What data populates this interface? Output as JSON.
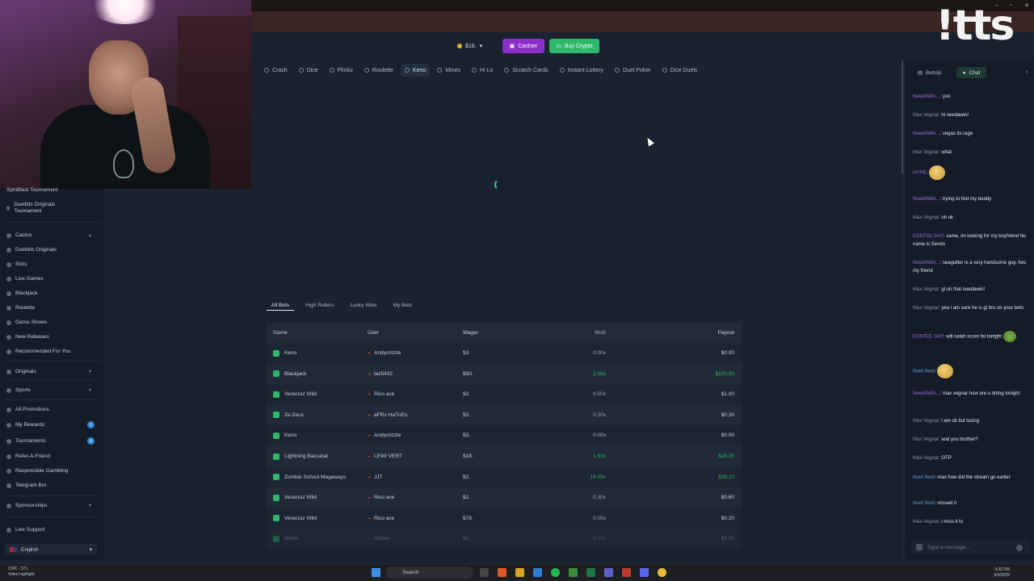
{
  "header": {
    "balance": "$18.",
    "cashier_label": "Cashier",
    "buycrypto_label": "Buy Crypto"
  },
  "game_nav": [
    {
      "label": "Crash",
      "icon": "crash-icon"
    },
    {
      "label": "Dice",
      "icon": "dice-icon"
    },
    {
      "label": "Plinko",
      "icon": "plinko-icon"
    },
    {
      "label": "Roulette",
      "icon": "roulette-icon"
    },
    {
      "label": "Keno",
      "icon": "keno-icon",
      "active": true
    },
    {
      "label": "Mines",
      "icon": "mines-icon"
    },
    {
      "label": "Hi Lo",
      "icon": "hilo-icon"
    },
    {
      "label": "Scratch Cards",
      "icon": "scratch-icon"
    },
    {
      "label": "Instant Lottery",
      "icon": "lottery-icon"
    },
    {
      "label": "Duel Poker",
      "icon": "poker-icon"
    },
    {
      "label": "Dice Duels",
      "icon": "dice-duels-icon"
    }
  ],
  "watermark": {
    "text": "!tts"
  },
  "sidebar": {
    "top_items": [
      "SpinBlast Tournament",
      "Duelbits Originals Tournament"
    ],
    "casino_label": "Casino",
    "casino_items": [
      "Duelbits Originals",
      "Slots",
      "Live Games",
      "Blackjack",
      "Roulette",
      "Game Shows",
      "New Releases",
      "Recommended For You"
    ],
    "originals_label": "Originals",
    "sports_label": "Sports",
    "promo_items": [
      "All Promotions",
      "My Rewards",
      "Tournaments",
      "Refer-A-Friend",
      "Responsible Gambling",
      "Telegram Bot"
    ],
    "badges": {
      "rewards": "1",
      "tournaments": "8"
    },
    "sponsorships_label": "Sponsorships",
    "live_support_label": "Live Support",
    "language": "English"
  },
  "bets": {
    "tabs": [
      "All Bets",
      "High Rollers",
      "Lucky Wins",
      "My Bets"
    ],
    "columns": [
      "Game",
      "User",
      "Wager",
      "Multi",
      "Payout"
    ],
    "rows": [
      {
        "game": "Keno",
        "user": "Andycrizzle",
        "wager": "$3.",
        "multi": "0.00x",
        "payout": "$0.00",
        "win": false
      },
      {
        "game": "Blackjack",
        "user": "taz5432",
        "wager": "$50.",
        "multi": "2.00x",
        "payout": "$100.00",
        "win": true
      },
      {
        "game": "Veracruz Wild",
        "user": "Rico ace",
        "wager": "$2.",
        "multi": "0.50x",
        "payout": "$1.00",
        "win": false
      },
      {
        "game": "Ze Zeus",
        "user": "aFRo HaTnEs",
        "wager": "$3.",
        "multi": "0.10x",
        "payout": "$0.30",
        "win": false
      },
      {
        "game": "Keno",
        "user": "Andycrizzle",
        "wager": "$3.",
        "multi": "0.00x",
        "payout": "$0.00",
        "win": false
      },
      {
        "game": "Lightning Baccarat",
        "user": "LEWI VERT",
        "wager": "$18.",
        "multi": "1.63x",
        "payout": "$29.25",
        "win": true
      },
      {
        "game": "Zombie School Megaways",
        "user": "JJT",
        "wager": "$2.",
        "multi": "19.55x",
        "payout": "$39.10",
        "win": true
      },
      {
        "game": "Veracruz Wild",
        "user": "Rico ace",
        "wager": "$2.",
        "multi": "0.30x",
        "payout": "$0.60",
        "win": false
      },
      {
        "game": "Veracruz Wild",
        "user": "Rico ace",
        "wager": "$79.",
        "multi": "0.00x",
        "payout": "$0.20",
        "win": false
      },
      {
        "game": "Mines",
        "user": "Hidden",
        "wager": "$2.",
        "multi": "0.00x",
        "payout": "$0.00",
        "win": false
      }
    ]
  },
  "chat": {
    "tabs": [
      "Betslip",
      "Chat"
    ],
    "messages": [
      {
        "name": "NeedAWin...",
        "text": "yoo",
        "color": "purple"
      },
      {
        "name": "Max Vegnar",
        "text": "hi needawin!",
        "color": "grey"
      },
      {
        "name": "NeedAWin...",
        "text": "vegas its rage",
        "color": "purple"
      },
      {
        "name": "Max Vegnar",
        "text": "what",
        "color": "grey"
      },
      {
        "name": "HYPE",
        "text": "",
        "color": "purple",
        "emote": "emote-icon"
      },
      {
        "name": "NeedAWin...",
        "text": "trying to find my buddy",
        "color": "purple"
      },
      {
        "name": "Max Vegnar",
        "text": "oh ok",
        "color": "grey"
      },
      {
        "name": "KONTOL GAY",
        "text": "same, im looking for my boyfriend his name is Sendo",
        "color": "purple"
      },
      {
        "name": "NeedAWin...",
        "text": "seagullier is a very handsome guy, hes my friend",
        "color": "purple"
      },
      {
        "name": "Max Vegnar",
        "text": "gl on that needawin!",
        "color": "grey"
      },
      {
        "name": "Max Vegnar",
        "text": "yea i am sure he is gl bro on your bets",
        "color": "grey"
      },
      {
        "name": "KONTOL GAY",
        "text": "will salah score fat tonight",
        "color": "purple",
        "emote": "frog-emote-icon"
      },
      {
        "name": "Noot Noot",
        "text": "",
        "color": "blue",
        "emote": "emote-icon"
      },
      {
        "name": "NeedAWin...",
        "text": "max vegnar how are u doing tonight",
        "color": "purple"
      },
      {
        "name": "Max Vegnar",
        "text": "i am ok but losing",
        "color": "grey"
      },
      {
        "name": "Max Vegnar",
        "text": "and you brother?",
        "color": "grey"
      },
      {
        "name": "Max Vegnar",
        "text": "OTP",
        "color": "grey"
      },
      {
        "name": "Noot Noot",
        "text": "max how did the stream go earlier",
        "color": "blue"
      },
      {
        "name": "Noot Noot",
        "text": "missed it",
        "color": "blue"
      },
      {
        "name": "Max Vegnar",
        "text": "i miss it to",
        "color": "grey"
      }
    ],
    "input_placeholder": "Type a message..."
  },
  "taskbar": {
    "left_line1": "CMC - STL",
    "left_line2": "Video highlight",
    "search_label": "Search",
    "time": "9:30 PM",
    "date": "6/9/2025"
  },
  "colors": {
    "cashier": "#8b2fc9",
    "buy_crypto": "#2fb86a",
    "accent_green": "#2fb86a",
    "background": "#1a2230"
  }
}
